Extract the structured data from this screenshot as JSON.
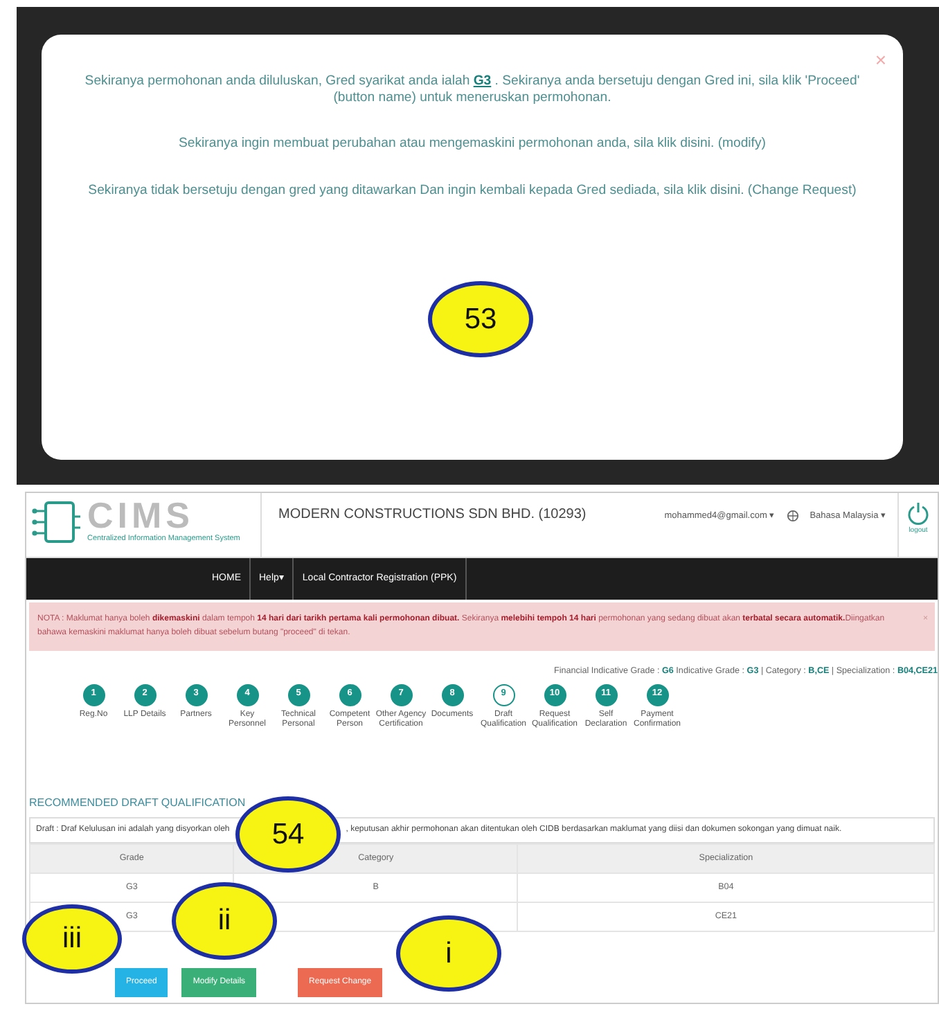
{
  "dialog": {
    "close": "×",
    "paragraphs": [
      "Sekiranya permohonan anda diluluskan, Gred syarikat anda ialah **G3** . Sekiranya anda bersetuju dengan Gred ini, sila klik 'Proceed' (button name) untuk meneruskan permohonan.",
      "Sekiranya ingin membuat perubahan atau mengemaskini permohonan anda, sila klik disini. (modify)",
      "Sekiranya tidak bersetuju dengan gred yang ditawarkan Dan ingin kembali kepada Gred sediada, sila klik disini. (Change Request)"
    ]
  },
  "header": {
    "logo_text": "CIMS",
    "logo_subtitle": "Centralized Information Management System",
    "company": "MODERN CONSTRUCTIONS SDN BHD. (10293)",
    "email": "mohammed4@gmail.com ▾",
    "language": "Bahasa Malaysia ▾",
    "logout": "logout"
  },
  "nav": [
    {
      "label": "HOME"
    },
    {
      "label": "Help▾"
    },
    {
      "label": "Local Contractor Registration (PPK)"
    }
  ],
  "alert": {
    "text": "NOTA : Maklumat hanya boleh **dikemaskini** dalam tempoh **14 hari dari tarikh pertama kali permohonan dibuat.** Sekiranya **melebihi tempoh 14 hari** permohonan yang sedang dibuat akan **terbatal secara automatik.**Diingatkan bahawa kemaskini maklumat hanya boleh dibuat sebelum butang \"proceed\" di tekan.",
    "close": "×"
  },
  "grade_info": "Financial Indicative Grade : **G6**  Indicative Grade : **G3** | Category : **B,CE** | Specialization : **B04,CE21**",
  "steps": [
    {
      "number": "1",
      "label": "Reg.No",
      "done": true
    },
    {
      "number": "2",
      "label": "LLP Details",
      "done": true
    },
    {
      "number": "3",
      "label": "Partners",
      "done": true
    },
    {
      "number": "4",
      "label": "Key Personnel",
      "done": true
    },
    {
      "number": "5",
      "label": "Technical Personal",
      "done": true
    },
    {
      "number": "6",
      "label": "Competent Person",
      "done": true
    },
    {
      "number": "7",
      "label": "Other Agency Certification",
      "done": true
    },
    {
      "number": "8",
      "label": "Documents",
      "done": true
    },
    {
      "number": "9",
      "label": "Draft Qualification",
      "done": false
    },
    {
      "number": "10",
      "label": "Request Qualification",
      "done": true
    },
    {
      "number": "11",
      "label": "Self Declaration",
      "done": true
    },
    {
      "number": "12",
      "label": "Payment Confirmation",
      "done": true
    }
  ],
  "section_title": "RECOMMENDED DRAFT QUALIFICATION",
  "draft_note": [
    "Draft : Draf Kelulusan ini adalah yang disyorkan oleh",
    ", keputusan akhir permohonan akan ditentukan oleh CIDB berdasarkan maklumat yang diisi dan dokumen sokongan yang dimuat naik."
  ],
  "table": {
    "columns": [
      "Grade",
      "Category",
      "Specialization"
    ],
    "rows": [
      [
        "G3",
        "B",
        "B04"
      ],
      [
        "G3",
        "",
        "CE21"
      ]
    ]
  },
  "buttons": [
    {
      "label": "Proceed",
      "kind": "info"
    },
    {
      "label": "Modify Details",
      "kind": "success"
    },
    {
      "label": "Request Change",
      "kind": "danger"
    }
  ],
  "callouts": [
    {
      "label": "53"
    },
    {
      "label": "54"
    },
    {
      "label": "iii"
    },
    {
      "label": "ii"
    },
    {
      "label": "i"
    }
  ]
}
